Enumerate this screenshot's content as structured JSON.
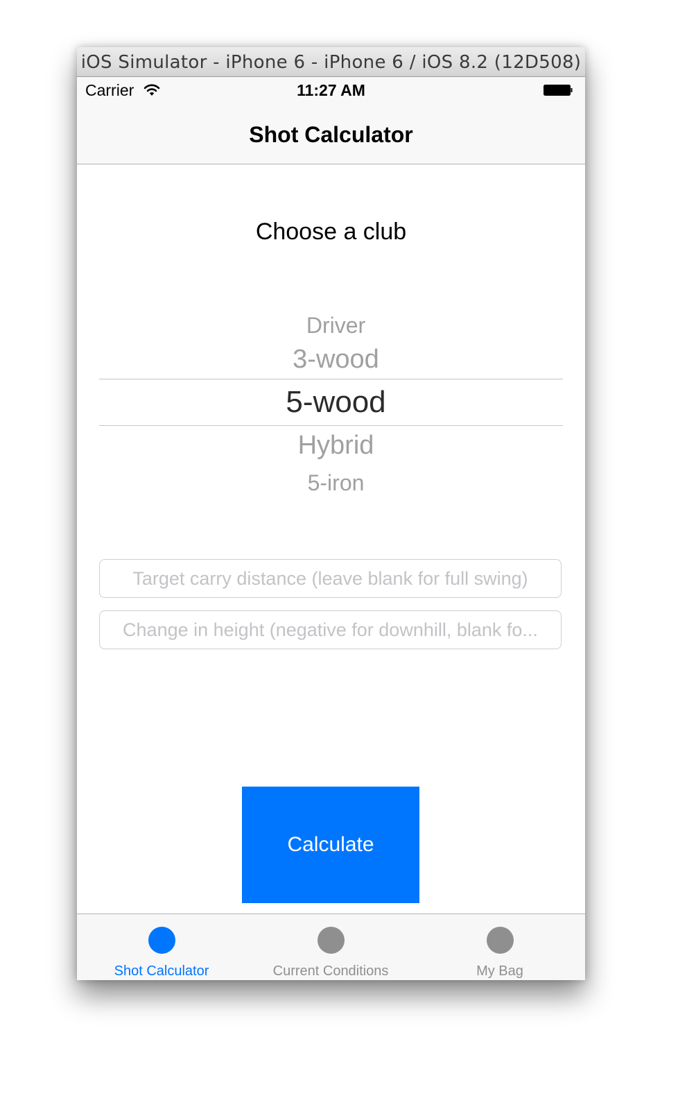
{
  "window": {
    "title": "iOS Simulator - iPhone 6 - iPhone 6 / iOS 8.2 (12D508)"
  },
  "status_bar": {
    "carrier": "Carrier",
    "time": "11:27 AM",
    "wifi_icon": "wifi-icon",
    "battery_icon": "battery-icon"
  },
  "nav_bar": {
    "title": "Shot Calculator"
  },
  "club_section": {
    "label": "Choose a club"
  },
  "club_picker": {
    "selected": "5-wood",
    "items": [
      "Driver",
      "3-wood",
      "5-wood",
      "Hybrid",
      "5-iron"
    ]
  },
  "inputs": {
    "target_distance": {
      "value": "",
      "placeholder": "Target carry distance (leave blank for full swing)"
    },
    "height_change": {
      "value": "",
      "placeholder": "Change in height (negative for downhill, blank fo..."
    }
  },
  "actions": {
    "calculate_label": "Calculate"
  },
  "tab_bar": {
    "selected": "Shot Calculator",
    "tabs": [
      {
        "label": "Shot Calculator"
      },
      {
        "label": "Current Conditions"
      },
      {
        "label": "My Bag"
      }
    ]
  },
  "colors": {
    "accent": "#0076ff",
    "inactive_tab": "#8f8f8f",
    "picker_unselected": "#a0a0a0",
    "picker_selected": "#2b2b2b"
  }
}
